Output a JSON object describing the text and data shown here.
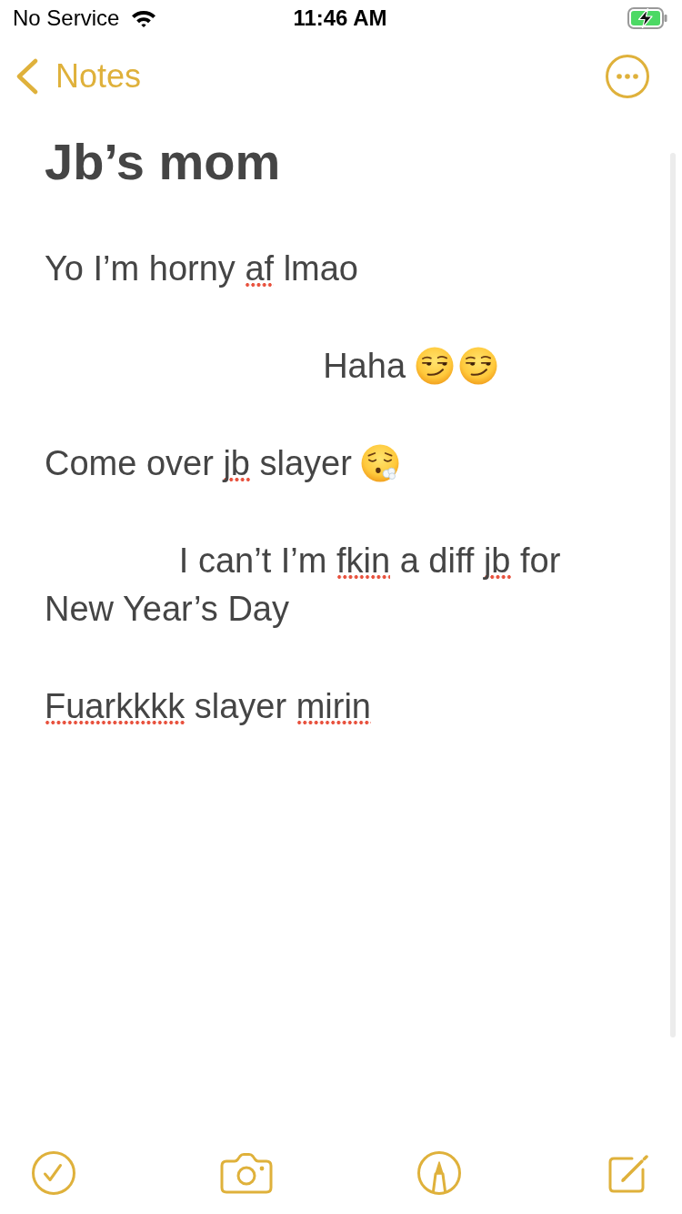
{
  "status_bar": {
    "carrier": "No Service",
    "time": "11:46 AM",
    "charging": true
  },
  "nav_bar": {
    "back_label": "Notes"
  },
  "note": {
    "title": "Jb’s mom",
    "paragraphs": [
      {
        "segments": [
          {
            "kind": "text",
            "text": "Yo I’m horny ",
            "misspelled": false
          },
          {
            "kind": "text",
            "text": "af",
            "misspelled": true
          },
          {
            "kind": "text",
            "text": " lmao",
            "misspelled": false
          }
        ]
      },
      {
        "segments": [
          {
            "kind": "text",
            "text": "                             Haha ",
            "misspelled": false
          },
          {
            "kind": "smirk"
          },
          {
            "kind": "smirk"
          }
        ]
      },
      {
        "segments": [
          {
            "kind": "text",
            "text": "Come over ",
            "misspelled": false
          },
          {
            "kind": "text",
            "text": "jb",
            "misspelled": true
          },
          {
            "kind": "text",
            "text": " slayer ",
            "misspelled": false
          },
          {
            "kind": "exhale"
          }
        ]
      },
      {
        "segments": [
          {
            "kind": "text",
            "text": "              I can’t I’m ",
            "misspelled": false
          },
          {
            "kind": "text",
            "text": "fkin",
            "misspelled": true
          },
          {
            "kind": "text",
            "text": " a diff ",
            "misspelled": false
          },
          {
            "kind": "text",
            "text": "jb",
            "misspelled": true
          },
          {
            "kind": "text",
            "text": " for New Year’s Day",
            "misspelled": false
          }
        ]
      },
      {
        "segments": [
          {
            "kind": "text",
            "text": "Fuarkkkk",
            "misspelled": true
          },
          {
            "kind": "text",
            "text": " slayer ",
            "misspelled": false
          },
          {
            "kind": "text",
            "text": "mirin",
            "misspelled": true
          }
        ]
      }
    ]
  }
}
